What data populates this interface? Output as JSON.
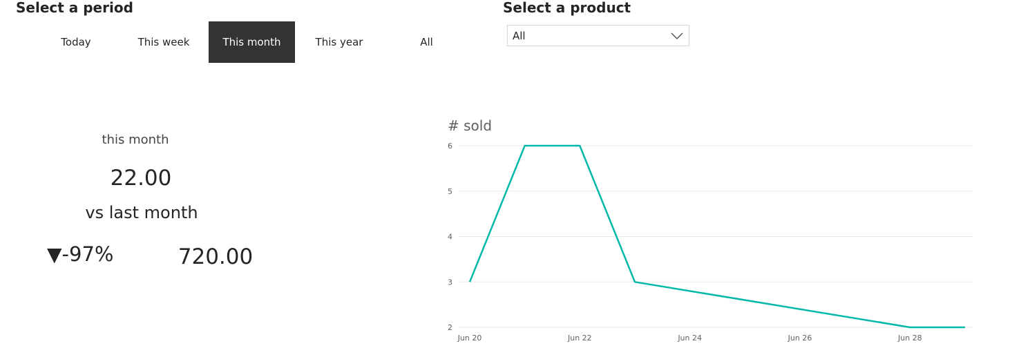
{
  "period": {
    "title": "Select a period",
    "options": [
      {
        "label": "Today",
        "selected": false
      },
      {
        "label": "This week",
        "selected": false
      },
      {
        "label": "This month",
        "selected": true
      },
      {
        "label": "This year",
        "selected": false
      },
      {
        "label": "All",
        "selected": false
      }
    ]
  },
  "product": {
    "title": "Select a product",
    "selected": "All",
    "icon": "chevron-down-icon"
  },
  "kpi": {
    "current_label": "this month",
    "current_value": "22.00",
    "compare_label": "vs last month",
    "change_arrow": "▼",
    "change_pct": "-97%",
    "previous_value": "720.00"
  },
  "colors": {
    "accent": "#01b8aa",
    "selected_bg": "#333333",
    "text": "#252423",
    "gridline": "#eaeaea"
  },
  "chart_data": {
    "type": "line",
    "title": "# sold",
    "xlabel": "",
    "ylabel": "",
    "ylim": [
      2,
      6
    ],
    "yticks": [
      2,
      3,
      4,
      5,
      6
    ],
    "xlim": [
      "2019-06-20",
      "2019-06-29"
    ],
    "xticks": [
      {
        "date": "2019-06-20",
        "label": "Jun 20"
      },
      {
        "date": "2019-06-22",
        "label": "Jun 22"
      },
      {
        "date": "2019-06-24",
        "label": "Jun 24"
      },
      {
        "date": "2019-06-26",
        "label": "Jun 26"
      },
      {
        "date": "2019-06-28",
        "label": "Jun 28"
      }
    ],
    "grid": true,
    "series": [
      {
        "x": [
          "2019-06-20",
          "2019-06-21",
          "2019-06-22",
          "2019-06-23",
          "2019-06-28",
          "2019-06-29"
        ],
        "y": [
          3,
          6,
          6,
          3,
          2,
          2
        ]
      }
    ]
  }
}
